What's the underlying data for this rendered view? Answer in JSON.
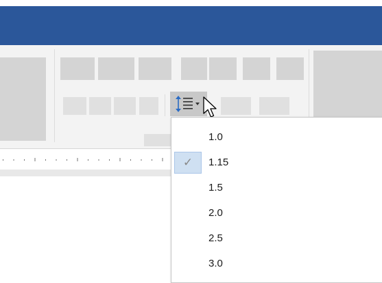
{
  "ribbon": {
    "line_spacing_button": {
      "icon": "line-spacing-icon",
      "dropdown": "dropdown-arrow-icon"
    }
  },
  "line_spacing_menu": {
    "items": [
      {
        "label": "1.0",
        "checked": false
      },
      {
        "label": "1.15",
        "checked": true
      },
      {
        "label": "1.5",
        "checked": false
      },
      {
        "label": "2.0",
        "checked": false
      },
      {
        "label": "2.5",
        "checked": false
      },
      {
        "label": "3.0",
        "checked": false
      }
    ],
    "check_glyph": "✓"
  },
  "colors": {
    "titlebar": "#2b579a",
    "ribbon": "#f3f3f3",
    "placeholder": "#d4d4d4",
    "selected_bg": "#cfe0f2"
  }
}
